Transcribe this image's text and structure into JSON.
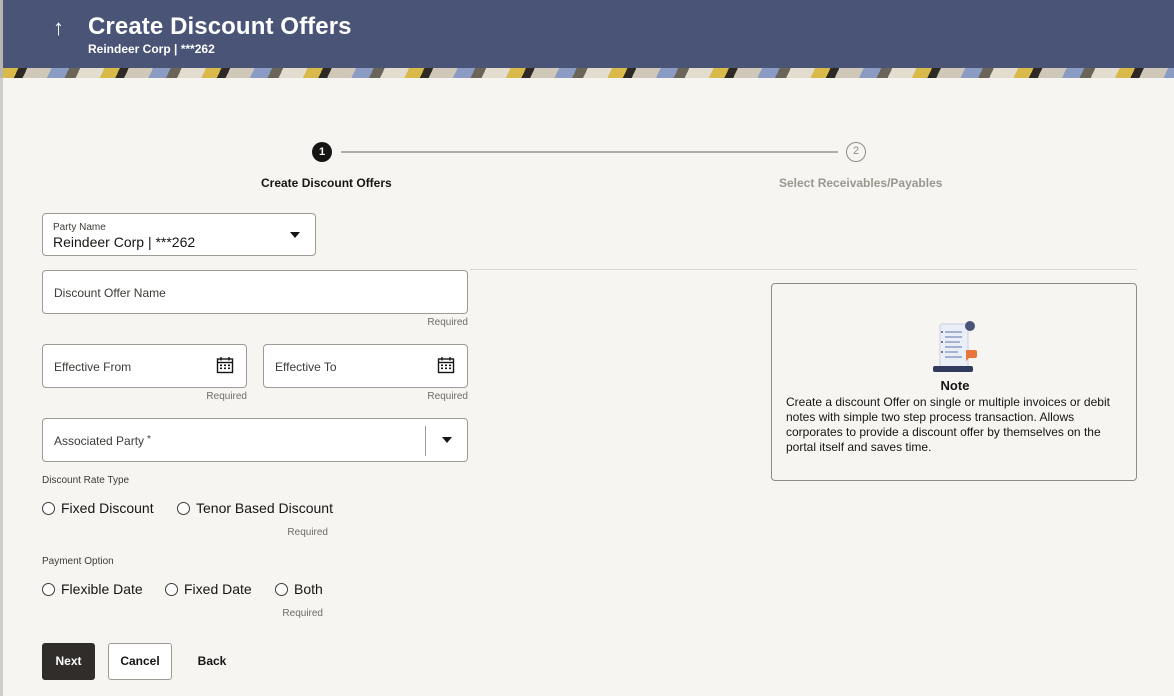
{
  "header": {
    "back_icon": "up-arrow-icon",
    "title": "Create Discount Offers",
    "subtitle": "Reindeer Corp | ***262"
  },
  "stepper": {
    "steps": [
      {
        "number": "1",
        "label": "Create Discount Offers",
        "active": true
      },
      {
        "number": "2",
        "label": "Select Receivables/Payables",
        "active": false
      }
    ]
  },
  "form": {
    "party": {
      "label": "Party Name",
      "value": "Reindeer Corp | ***262"
    },
    "offer_name": {
      "label": "Discount Offer Name",
      "hint": "Required"
    },
    "effective_from": {
      "label": "Effective From",
      "hint": "Required",
      "icon": "calendar-icon"
    },
    "effective_to": {
      "label": "Effective To",
      "hint": "Required",
      "icon": "calendar-icon"
    },
    "associated_party": {
      "label": "Associated Party",
      "required_mark": "*"
    },
    "discount_rate_type": {
      "label": "Discount Rate Type",
      "options": [
        "Fixed Discount",
        "Tenor Based Discount"
      ],
      "hint": "Required"
    },
    "payment_option": {
      "label": "Payment Option",
      "options": [
        "Flexible Date",
        "Fixed Date",
        "Both"
      ],
      "hint": "Required"
    }
  },
  "note": {
    "title": "Note",
    "text": "Create a discount Offer on single or multiple invoices or debit notes with simple two step process transaction. Allows corporates to provide a discount offer by themselves on the portal itself and saves time."
  },
  "buttons": {
    "next": "Next",
    "cancel": "Cancel",
    "back": "Back"
  },
  "colors": {
    "header_bg": "#4a5476",
    "primary_button": "#312d2a",
    "page_bg": "#f6f5f2"
  }
}
